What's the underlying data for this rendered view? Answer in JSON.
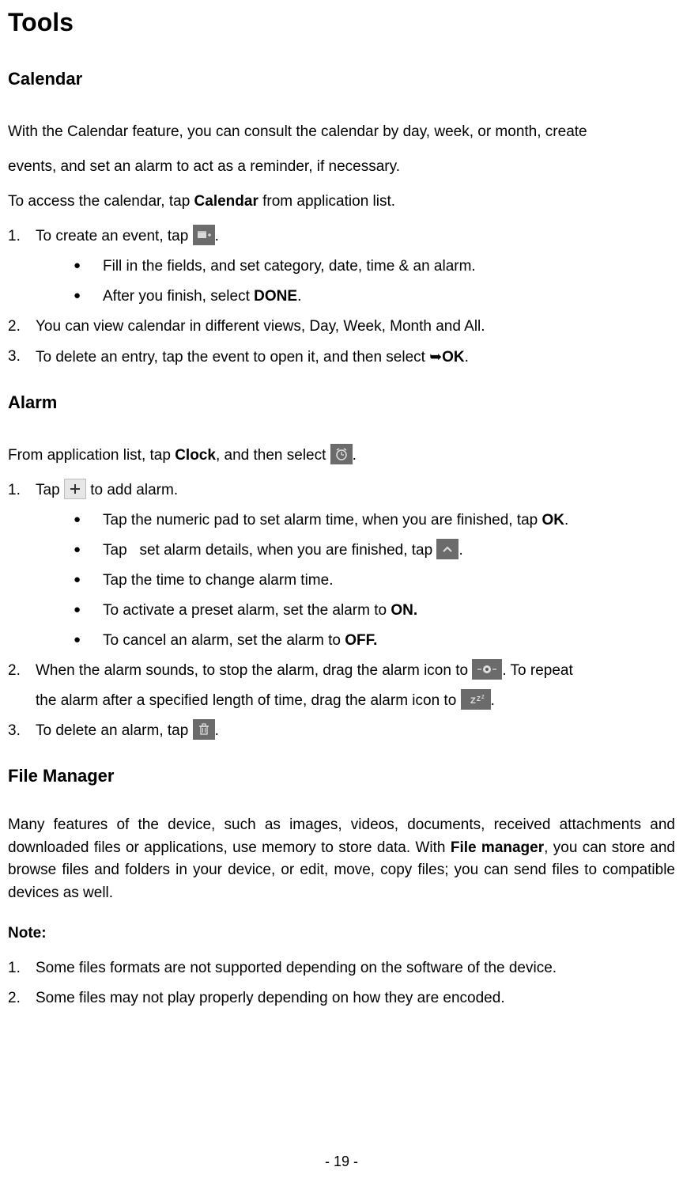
{
  "title": "Tools",
  "calendar": {
    "heading": "Calendar",
    "intro1_a": "With the Calendar feature, you can consult the calendar by day, week, or month, create",
    "intro1_b": "events, and set an alarm to act as a reminder, if necessary.",
    "access_a": "To access the calendar, tap ",
    "access_b": " from application list.",
    "access_bold": "Calendar",
    "li1_num": "1.",
    "li1_a": "To create an event, tap ",
    "li1_b": ".",
    "sub1": "Fill in the fields, and set category, date, time & an alarm.",
    "sub2_a": "After you finish, select ",
    "sub2_b": ".",
    "sub2_bold": "DONE",
    "li2_num": "2.",
    "li2": "You can view calendar in different views, Day, Week, Month and All.",
    "li3_num": "3.",
    "li3_a": "To delete an entry, tap the event to open it, and then select ",
    "li3_b": ".",
    "li3_bold": "OK",
    "arrow": "➥"
  },
  "alarm": {
    "heading": "Alarm",
    "intro_a": "From application list, tap ",
    "intro_bold": "Clock",
    "intro_b": ", and then select ",
    "intro_c": ".",
    "li1_num": "1.",
    "li1_a": "Tap ",
    "li1_b": " to add alarm.",
    "sub1_a": "Tap the numeric pad to set alarm time, when you are finished, tap ",
    "sub1_b": ".",
    "sub1_bold": "OK",
    "sub2_a": "Tap   set alarm details, when you are finished, tap ",
    "sub2_b": ".",
    "sub3": "Tap the time to change alarm time.",
    "sub4_a": "To activate a preset alarm, set the alarm to ",
    "sub4_bold": "ON.",
    "sub5_a": "To cancel an alarm, set the alarm to ",
    "sub5_bold": "OFF.",
    "li2_num": "2.",
    "li2_a": "When the alarm sounds, to stop the alarm, drag the alarm icon to ",
    "li2_b": ". To repeat",
    "li2_c": "the alarm after a specified length of time, drag the alarm icon to ",
    "li2_d": ".",
    "li3_num": "3.",
    "li3_a": "To delete an alarm, tap ",
    "li3_b": "."
  },
  "filemgr": {
    "heading": "File Manager",
    "p1": "Many features of the device, such as images, videos, documents, received attachments and downloaded files or applications, use memory to store data. With ",
    "p1_bold": "File manager",
    "p1_b": ", you can store and browse files and folders in your device, or edit, move, copy files; you can send files to compatible devices as well.",
    "note_label": "Note:",
    "li1_num": "1.",
    "li1": "Some files formats are not supported depending on the software of the device.",
    "li2_num": "2.",
    "li2": "Some files may not play properly depending on how they are encoded."
  },
  "page_number": "- 19 -"
}
